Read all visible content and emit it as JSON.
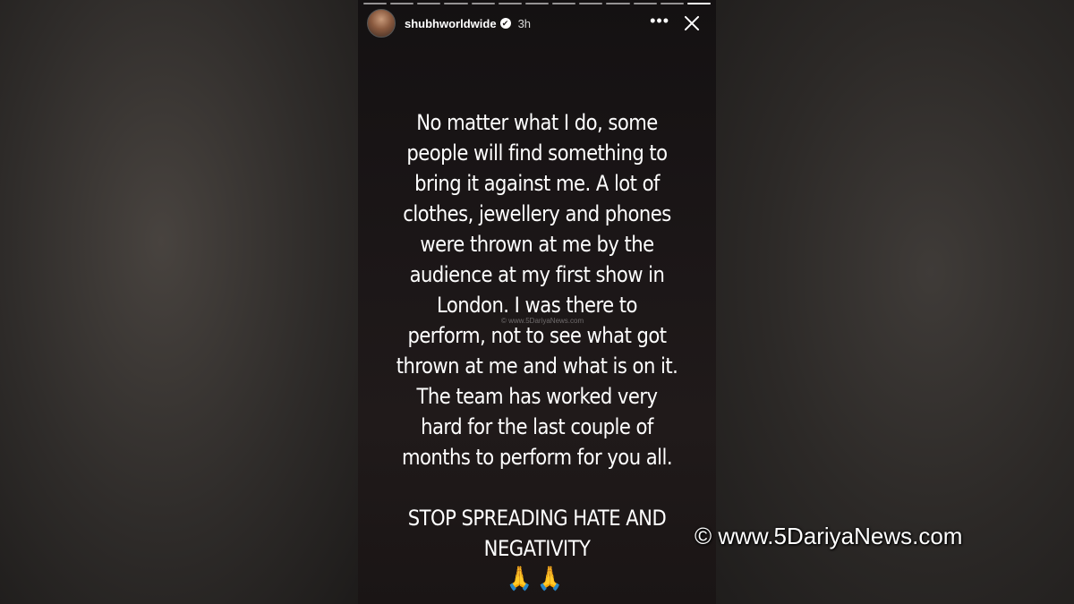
{
  "story": {
    "username": "shubhworldwide",
    "verified_mark": "✔",
    "time_ago": "3h",
    "more_label": "•••",
    "paragraphs": [
      "No matter what I do, some people will find something to bring it against me. A lot of clothes, jewellery and phones were thrown at me by the audience at my first show in London. I was there to perform, not to see what got thrown at me and what is on it. The team has worked very hard for the last couple of months to perform for you all.",
      "STOP SPREADING HATE AND NEGATIVITY"
    ],
    "emojis": "🙏🙏",
    "inner_watermark": "© www.5DariyaNews.com",
    "progress_segments": 13,
    "icons": [
      "verified-icon",
      "more-options-icon",
      "close-icon"
    ]
  },
  "watermark": "© www.5DariyaNews.com"
}
